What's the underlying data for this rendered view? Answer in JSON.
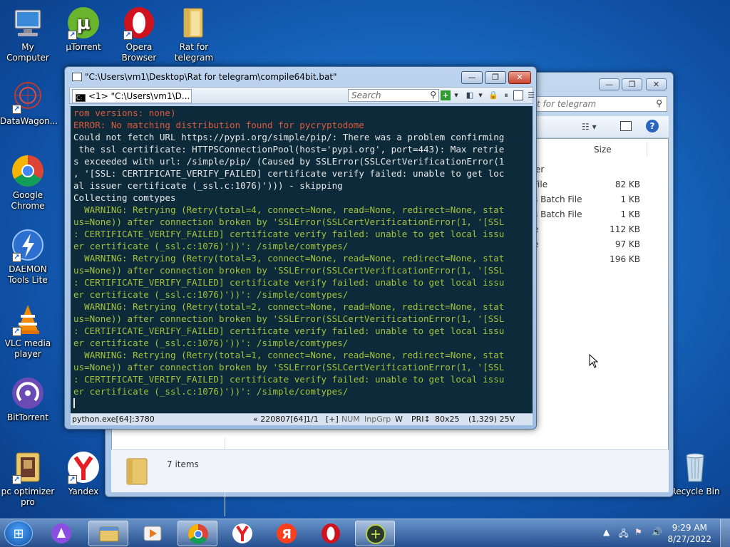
{
  "desktop": {
    "icons": [
      {
        "label": "My Computer",
        "icon": "computer-icon"
      },
      {
        "label": "µTorrent",
        "icon": "utorrent-icon"
      },
      {
        "label": "Opera Browser",
        "icon": "opera-icon"
      },
      {
        "label": "Rat for telegram",
        "icon": "folder-icon"
      },
      {
        "label": "DataWagon...",
        "icon": "datawagon-icon"
      },
      {
        "label": "Google Chrome",
        "icon": "chrome-icon"
      },
      {
        "label": "DAEMON Tools Lite",
        "icon": "daemon-tools-icon"
      },
      {
        "label": "VLC media player",
        "icon": "vlc-icon"
      },
      {
        "label": "BitTorrent",
        "icon": "bittorrent-icon"
      },
      {
        "label": "pc optimizer pro",
        "icon": "pc-optimizer-icon"
      },
      {
        "label": "Yandex",
        "icon": "yandex-icon"
      },
      {
        "label": "Recycle Bin",
        "icon": "recycle-bin-icon"
      }
    ]
  },
  "explorer": {
    "search_placeholder": "t for telegram",
    "column_size": "Size",
    "group_label": "er",
    "rows": [
      {
        "type": "File",
        "size": "82 KB"
      },
      {
        "type": "s Batch File",
        "size": "1 KB"
      },
      {
        "type": "s Batch File",
        "size": "1 KB"
      },
      {
        "type": "e",
        "size": "112 KB"
      },
      {
        "type": "e",
        "size": "97 KB"
      },
      {
        "type": "",
        "size": "196 KB"
      }
    ],
    "item_count": "7 items"
  },
  "console": {
    "title": "\"C:\\Users\\vm1\\Desktop\\Rat for telegram\\compile64bit.bat\"",
    "tab_label": "<1> \"C:\\Users\\vm1\\D...",
    "search_placeholder": "Search",
    "lines": [
      {
        "text": "rom versions: none)",
        "style": "err"
      },
      {
        "text": "ERROR: No matching distribution found for pycryptodome",
        "style": "err"
      },
      {
        "text": "Could not fetch URL https://pypi.org/simple/pip/: There was a problem confirming",
        "style": "norm"
      },
      {
        "text": " the ssl certificate: HTTPSConnectionPool(host='pypi.org', port=443): Max retrie",
        "style": "norm"
      },
      {
        "text": "s exceeded with url: /simple/pip/ (Caused by SSLError(SSLCertVerificationError(1",
        "style": "norm"
      },
      {
        "text": ", '[SSL: CERTIFICATE_VERIFY_FAILED] certificate verify failed: unable to get loc",
        "style": "norm"
      },
      {
        "text": "al issuer certificate (_ssl.c:1076)'))) - skipping",
        "style": "norm"
      },
      {
        "text": "Collecting comtypes",
        "style": "norm"
      },
      {
        "text": "  WARNING: Retrying (Retry(total=4, connect=None, read=None, redirect=None, stat",
        "style": "warn"
      },
      {
        "text": "us=None)) after connection broken by 'SSLError(SSLCertVerificationError(1, '[SSL",
        "style": "warn"
      },
      {
        "text": ": CERTIFICATE_VERIFY_FAILED] certificate verify failed: unable to get local issu",
        "style": "warn"
      },
      {
        "text": "er certificate (_ssl.c:1076)'))': /simple/comtypes/",
        "style": "warn"
      },
      {
        "text": "  WARNING: Retrying (Retry(total=3, connect=None, read=None, redirect=None, stat",
        "style": "warn"
      },
      {
        "text": "us=None)) after connection broken by 'SSLError(SSLCertVerificationError(1, '[SSL",
        "style": "warn"
      },
      {
        "text": ": CERTIFICATE_VERIFY_FAILED] certificate verify failed: unable to get local issu",
        "style": "warn"
      },
      {
        "text": "er certificate (_ssl.c:1076)'))': /simple/comtypes/",
        "style": "warn"
      },
      {
        "text": "  WARNING: Retrying (Retry(total=2, connect=None, read=None, redirect=None, stat",
        "style": "warn"
      },
      {
        "text": "us=None)) after connection broken by 'SSLError(SSLCertVerificationError(1, '[SSL",
        "style": "warn"
      },
      {
        "text": ": CERTIFICATE_VERIFY_FAILED] certificate verify failed: unable to get local issu",
        "style": "warn"
      },
      {
        "text": "er certificate (_ssl.c:1076)'))': /simple/comtypes/",
        "style": "warn"
      },
      {
        "text": "  WARNING: Retrying (Retry(total=1, connect=None, read=None, redirect=None, stat",
        "style": "warn"
      },
      {
        "text": "us=None)) after connection broken by 'SSLError(SSLCertVerificationError(1, '[SSL",
        "style": "warn"
      },
      {
        "text": ": CERTIFICATE_VERIFY_FAILED] certificate verify failed: unable to get local issu",
        "style": "warn"
      },
      {
        "text": "er certificate (_ssl.c:1076)'))': /simple/comtypes/",
        "style": "warn"
      }
    ],
    "status": {
      "process": "python.exe[64]:3780",
      "build": "« 220807[64]",
      "pane": "1/1",
      "plus": "[+]",
      "num": "NUM",
      "inpgrp": "InpGrp",
      "w": "W",
      "pri": "PRI↕",
      "size": "80x25",
      "cursor_pos": "(1,329) 25V"
    },
    "colors": {
      "error": "#e0583a",
      "normal": "#e8e8e8",
      "warning": "#a4c23a",
      "background": "#0c2a3a"
    }
  },
  "taskbar": {
    "items": [
      {
        "icon": "alice-icon"
      },
      {
        "icon": "explorer-icon"
      },
      {
        "icon": "media-player-icon"
      },
      {
        "icon": "chrome-icon"
      },
      {
        "icon": "yandex-browser-icon"
      },
      {
        "icon": "yandex-icon"
      },
      {
        "icon": "opera-icon"
      },
      {
        "icon": "conemu-icon"
      }
    ],
    "time": "9:29 AM",
    "date": "8/27/2022"
  }
}
